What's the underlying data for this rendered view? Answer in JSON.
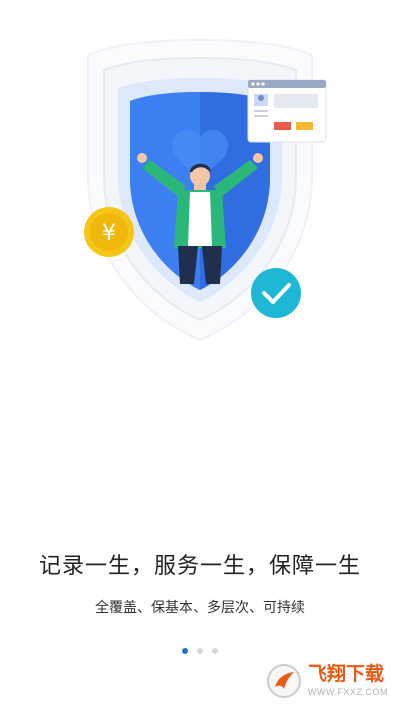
{
  "onboarding": {
    "headline": "记录一生，服务一生，保障一生",
    "subline": "全覆盖、保基本、多层次、可持续",
    "page_indicator": {
      "total": 3,
      "active": 1
    }
  },
  "illustration": {
    "coin_symbol": "¥",
    "colors": {
      "shield_blue": "#2f6de0",
      "shield_light": "#3c86f0",
      "coin_yellow": "#f5c518",
      "check_teal": "#1fb7d6",
      "jacket_green": "#2cb77a"
    }
  },
  "watermark": {
    "brand": "飞翔下载",
    "url": "WWW.FXXZ.COM"
  }
}
